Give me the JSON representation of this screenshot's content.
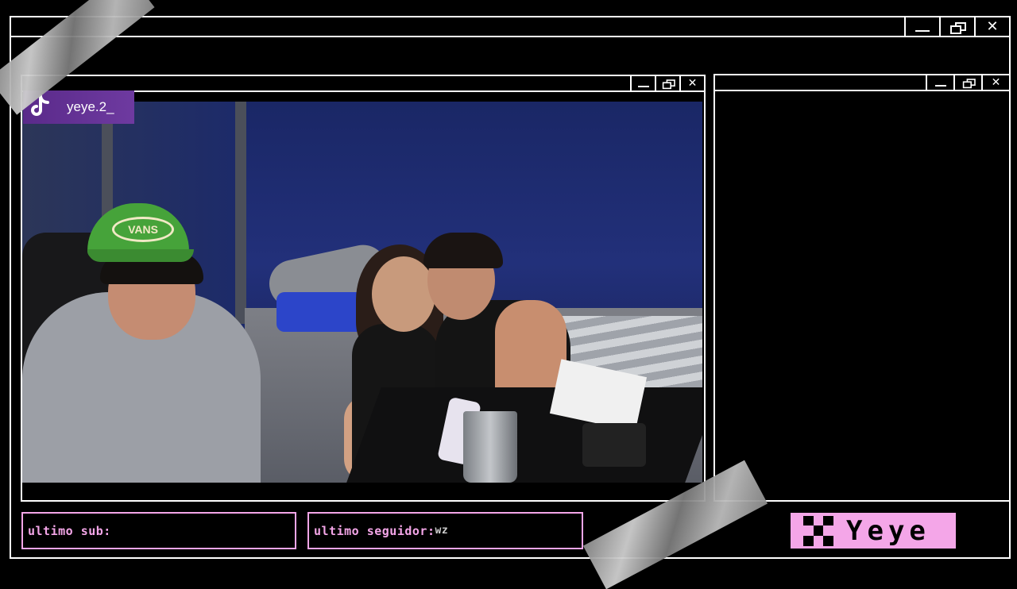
{
  "outer_window": {
    "controls": {
      "minimize": "minimize",
      "restore": "restore",
      "close": "✕"
    }
  },
  "camera_window": {
    "controls": {
      "close": "✕"
    }
  },
  "side_window": {
    "controls": {
      "close": "✕"
    }
  },
  "tiktok_badge": {
    "icon": "tiktok-icon",
    "username": "yeye.2_"
  },
  "cap_logo": "VANS",
  "last_sub": {
    "label": "ultimo sub:",
    "value": ""
  },
  "last_follower": {
    "label": "ultimo seguidor:",
    "value": "wz"
  },
  "brand": {
    "icon": "checker-icon",
    "name": "Yeye"
  },
  "colors": {
    "accent": "#f4a6e8",
    "frame": "#ffffff",
    "background": "#000000",
    "badge": "#6e3aa0"
  }
}
